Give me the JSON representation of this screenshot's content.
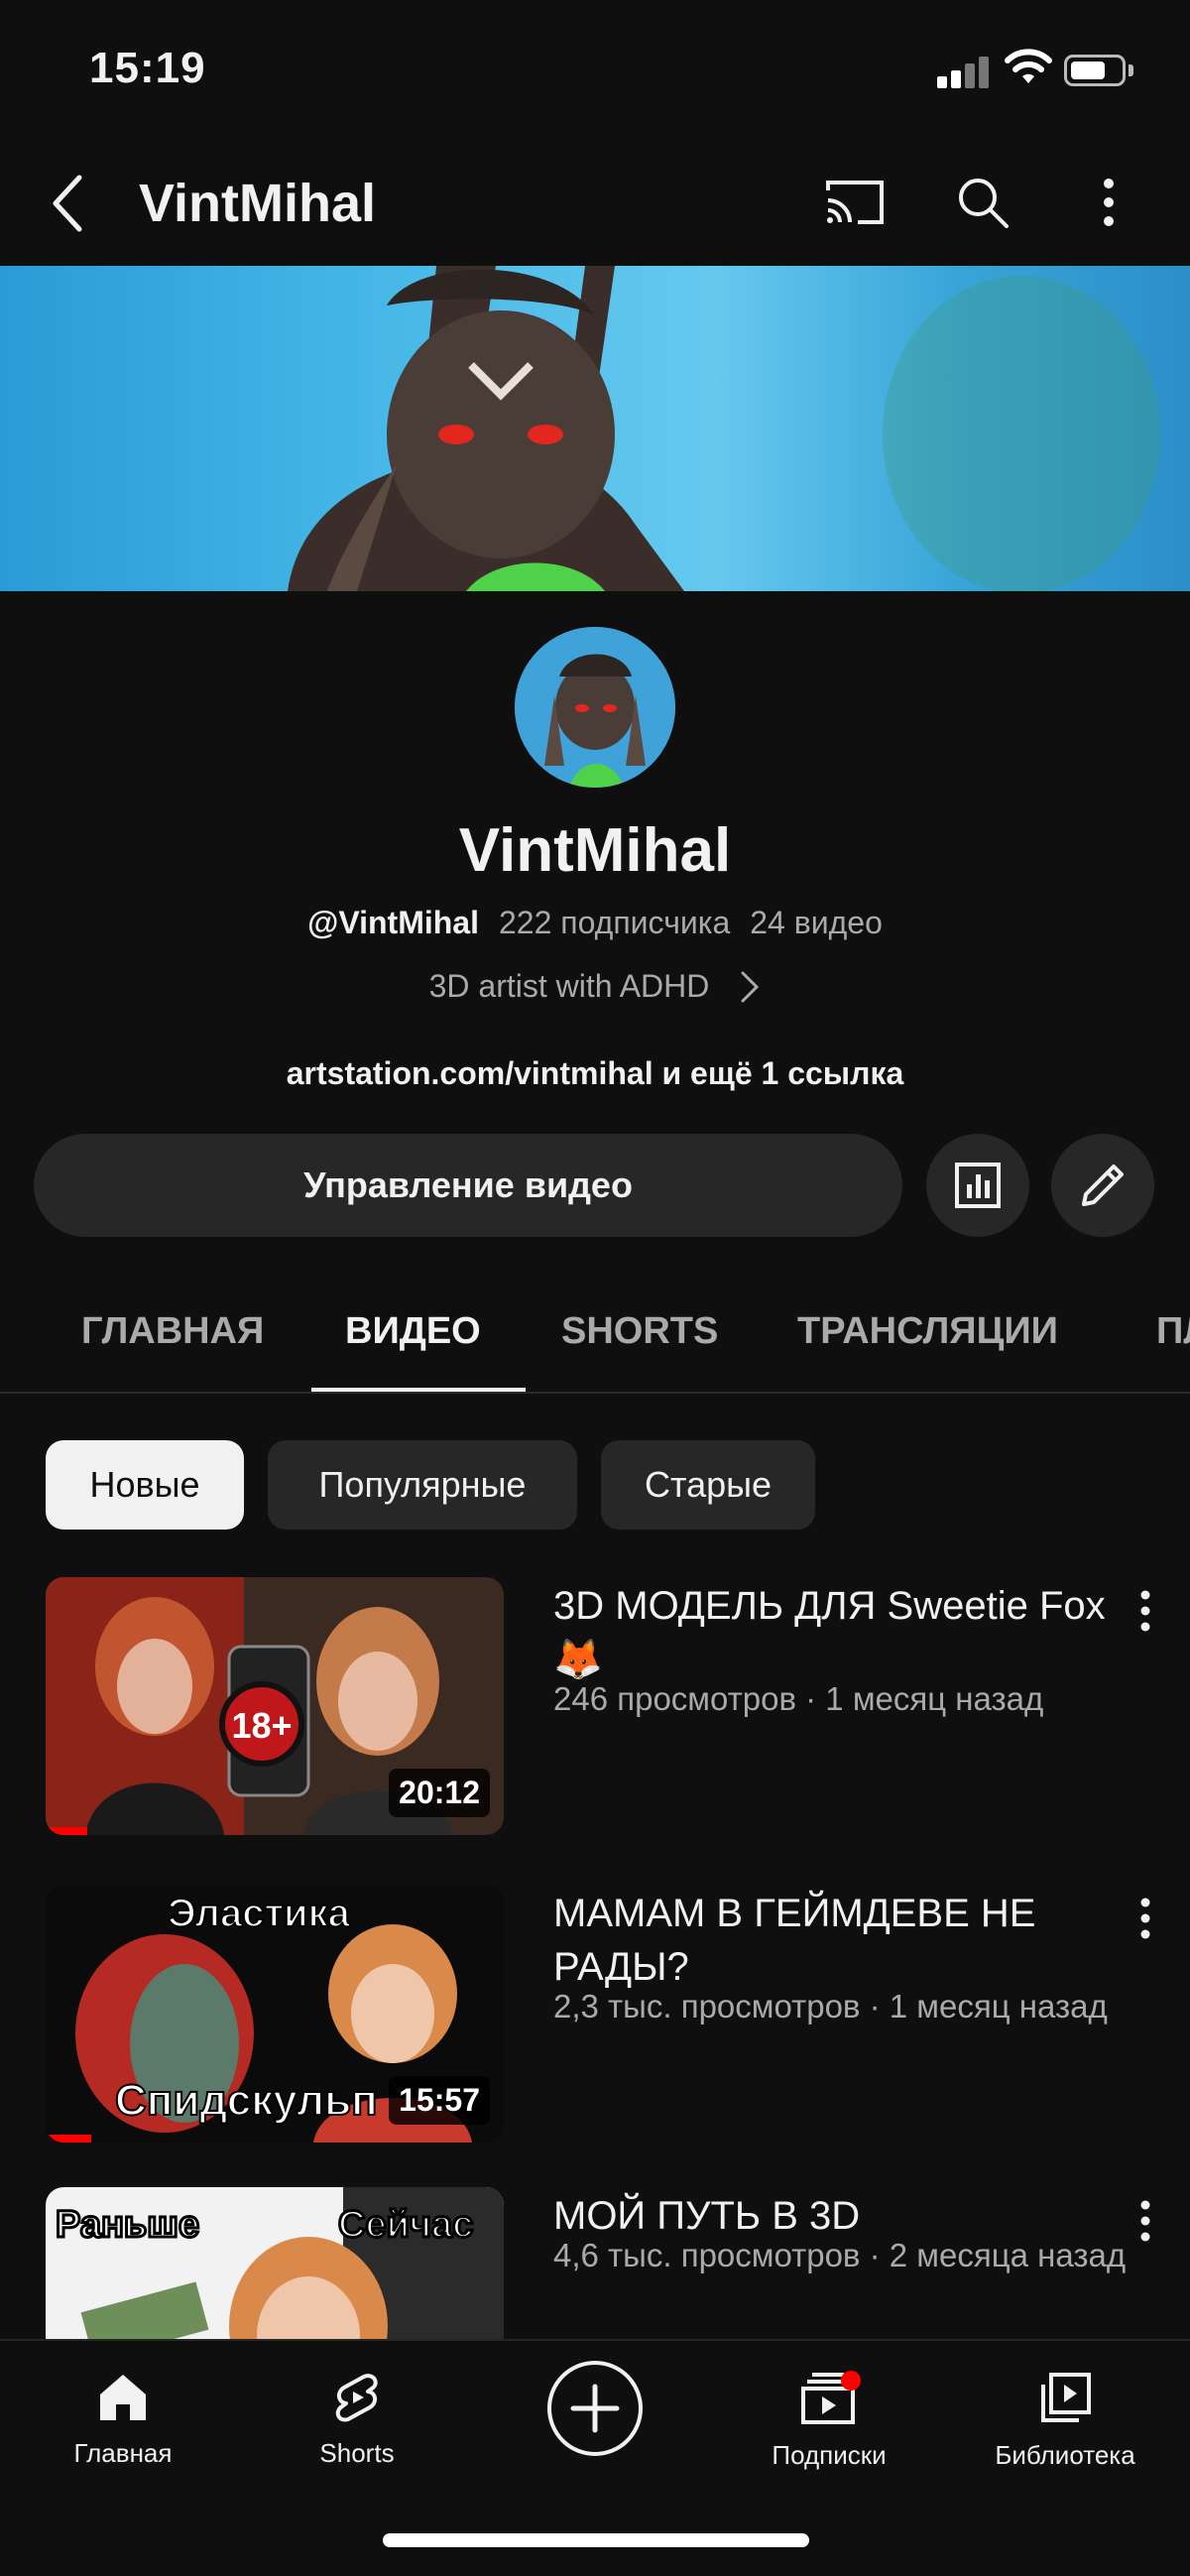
{
  "status_bar": {
    "time": "15:19"
  },
  "app_bar": {
    "title": "VintMihal"
  },
  "channel": {
    "name": "VintMihal",
    "handle": "@VintMihal",
    "subscribers": "222 подписчика",
    "videos_count": "24 видео",
    "description": "3D artist with ADHD",
    "links": "artstation.com/vintmihal и ещё 1 ссылка"
  },
  "actions": {
    "manage_label": "Управление видео"
  },
  "tabs": [
    {
      "label": "ГЛАВНАЯ"
    },
    {
      "label": "ВИДЕО"
    },
    {
      "label": "SHORTS"
    },
    {
      "label": "ТРАНСЛЯЦИИ"
    },
    {
      "label": "ПЛ"
    }
  ],
  "chips": [
    {
      "label": "Новые"
    },
    {
      "label": "Популярные"
    },
    {
      "label": "Старые"
    }
  ],
  "videos": [
    {
      "title": "3D МОДЕЛЬ ДЛЯ Sweetie Fox 🦊",
      "meta": "246 просмотров · 1 месяц назад",
      "duration": "20:12",
      "thumb_text": "18+",
      "watched_fraction": 0.09
    },
    {
      "title": "МАМАМ В ГЕЙМДЕВЕ НЕ РАДЫ?",
      "meta": "2,3 тыс. просмотров · 1 месяц назад",
      "duration": "15:57",
      "thumb_text_top": "Эластика",
      "thumb_text_bottom": "Спидскульп",
      "watched_fraction": 0.1
    },
    {
      "title": "МОЙ ПУТЬ В 3D",
      "meta": "4,6 тыс. просмотров · 2 месяца назад",
      "thumb_text_left": "Раньше",
      "thumb_text_right": "Сейчас"
    }
  ],
  "bottom_nav": [
    {
      "label": "Главная",
      "icon": "home-icon"
    },
    {
      "label": "Shorts",
      "icon": "shorts-icon"
    },
    {
      "label": "Подписки",
      "icon": "subscriptions-icon"
    },
    {
      "label": "Библиотека",
      "icon": "library-icon"
    }
  ],
  "colors": {
    "background": "#0f0f0f",
    "accent": "#ff0000",
    "chip_active": "#f1f1f1"
  }
}
